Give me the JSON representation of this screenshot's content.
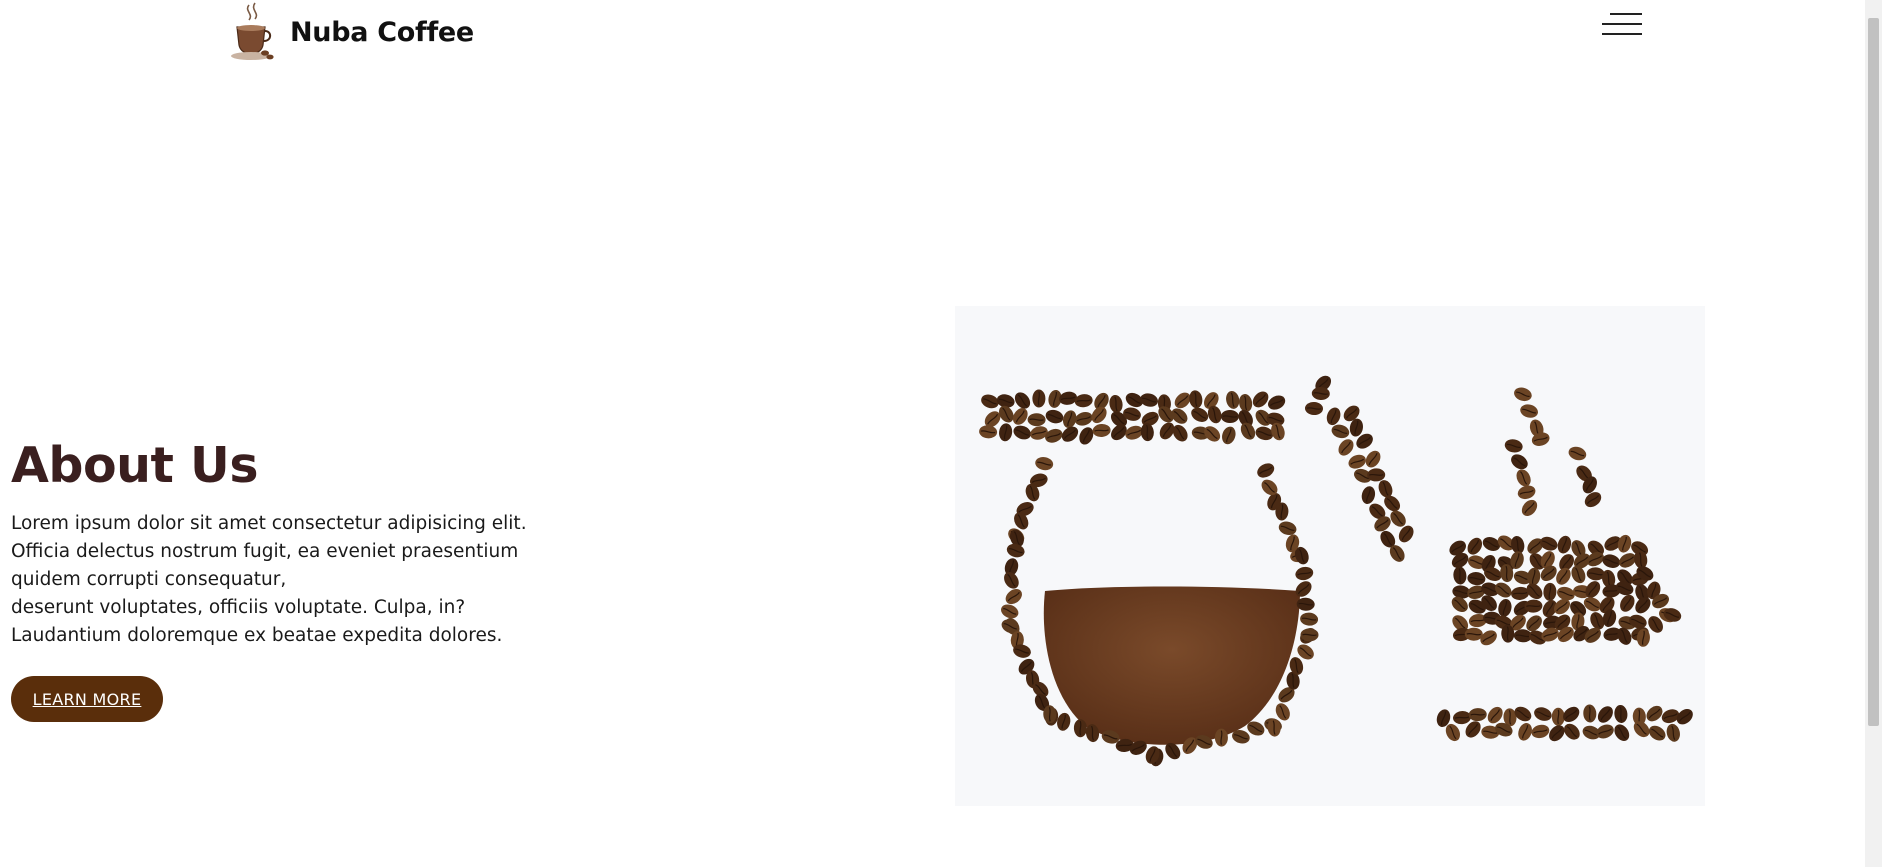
{
  "header": {
    "brand_name": "Nuba Coffee",
    "logo_icon": "coffee-cup-logo",
    "menu_icon": "hamburger-menu-icon"
  },
  "about": {
    "title": "About Us",
    "paragraph_lines": [
      "Lorem ipsum dolor sit amet consectetur adipisicing elit.",
      "Officia delectus nostrum fugit, ea eveniet praesentium",
      "quidem corrupti consequatur,",
      "deserunt voluptates, officiis voluptate. Culpa, in?",
      "Laudantium doloremque ex beatae expedita dolores."
    ],
    "button_label": "LEARN MORE"
  },
  "image": {
    "subject": "coffee-beans-pot-and-cup"
  },
  "colors": {
    "heading": "#3a1f1f",
    "button_bg": "#5a2e0b",
    "bean": "#5b3a1e",
    "ground_coffee": "#6b3f22"
  }
}
